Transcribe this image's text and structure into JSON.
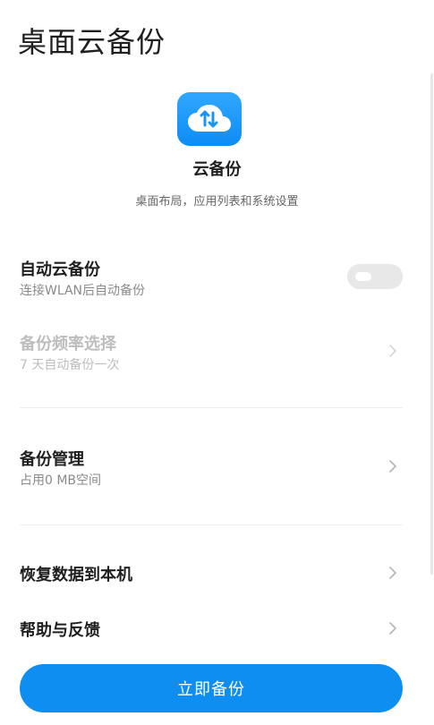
{
  "header": {
    "title": "桌面云备份"
  },
  "hero": {
    "icon": "cloud-sync-icon",
    "name": "云备份",
    "description": "桌面布局，应用列表和系统设置"
  },
  "settings": {
    "auto_backup": {
      "title": "自动云备份",
      "subtitle": "连接WLAN后自动备份",
      "enabled": false
    },
    "frequency": {
      "title": "备份频率选择",
      "subtitle": "7 天自动备份一次",
      "disabled": true
    },
    "management": {
      "title": "备份管理",
      "subtitle": "占用0 MB空间"
    },
    "restore": {
      "title": "恢复数据到本机"
    },
    "help": {
      "title": "帮助与反馈"
    }
  },
  "action": {
    "backup_now_label": "立即备份"
  },
  "colors": {
    "accent": "#0d8ef0",
    "icon_gradient_top": "#30a8ff",
    "toggle_off": "#e8e8e8"
  }
}
